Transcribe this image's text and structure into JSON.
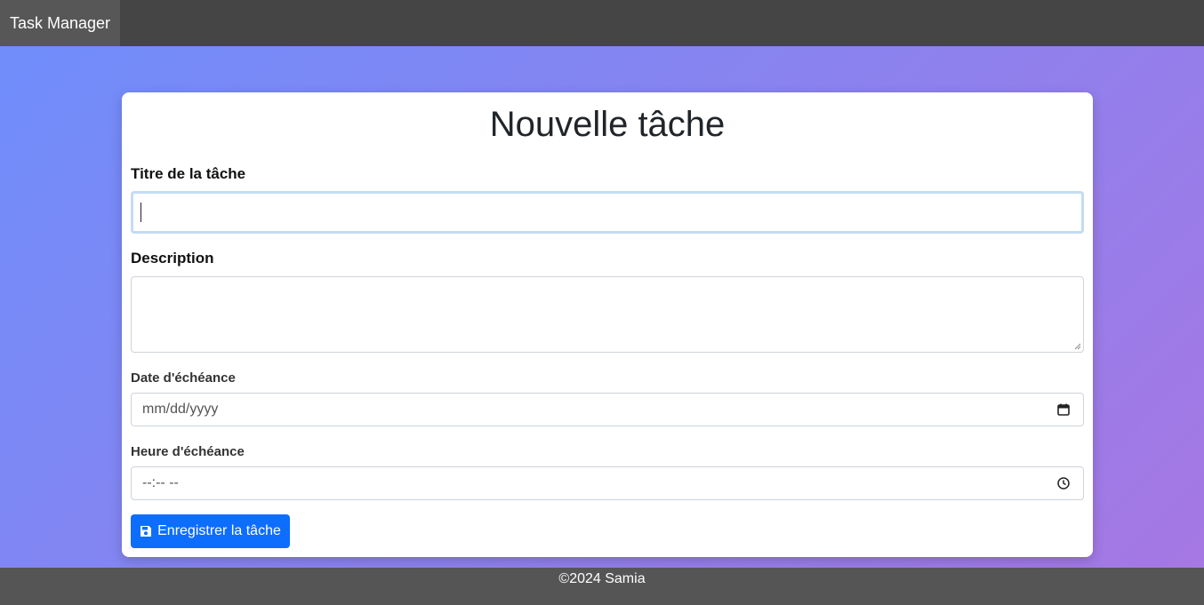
{
  "navbar": {
    "brand": "Task Manager"
  },
  "form": {
    "heading": "Nouvelle tâche",
    "title_label": "Titre de la tâche",
    "title_value": "",
    "description_label": "Description",
    "description_value": "",
    "date_label": "Date d'échéance",
    "date_placeholder": "mm/dd/yyyy",
    "time_label": "Heure d'échéance",
    "time_placeholder": "--:-- --",
    "submit_label": "Enregistrer la tâche"
  },
  "footer": {
    "text": "©2024 Samia"
  },
  "colors": {
    "accent": "#0d6efd",
    "navbar": "#454545",
    "footer": "#555555",
    "gradient_start": "#6e8efb",
    "gradient_end": "#a777e3"
  },
  "icons": {
    "submit": "save-icon",
    "date": "calendar-icon",
    "time": "clock-icon"
  }
}
